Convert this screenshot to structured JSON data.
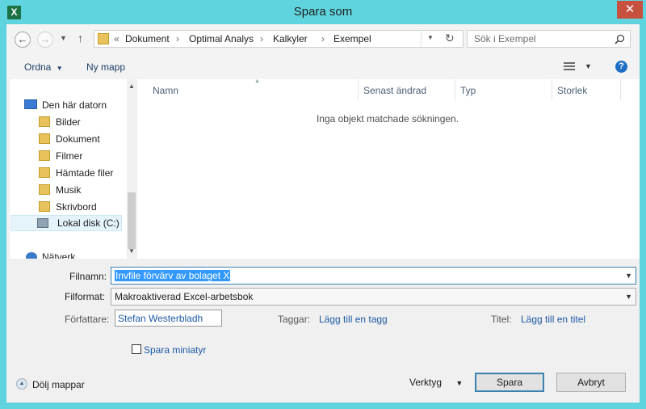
{
  "window": {
    "title": "Spara som",
    "close_glyph": "✕",
    "app_icon_letter": "X"
  },
  "address": {
    "crumbs": [
      "Dokument",
      "Optimal Analys",
      "Kalkyler",
      "Exempel"
    ],
    "overflow": "«",
    "search_placeholder": "Sök i Exempel"
  },
  "toolbar": {
    "organize": "Ordna",
    "new_folder": "Ny mapp",
    "help": "?"
  },
  "nav": {
    "this_pc": "Den här datorn",
    "items": [
      "Bilder",
      "Dokument",
      "Filmer",
      "Hämtade filer",
      "Musik",
      "Skrivbord"
    ],
    "local_disk": "Lokal disk (C:)",
    "network": "Nätverk"
  },
  "list": {
    "columns": [
      "Namn",
      "Senast ändrad",
      "Typ",
      "Storlek"
    ],
    "empty_message": "Inga objekt matchade sökningen."
  },
  "form": {
    "filename_label": "Filnamn:",
    "filename_value": "Invfile förvärv av bolaget X",
    "format_label": "Filformat:",
    "format_value": "Makroaktiverad Excel-arbetsbok",
    "author_label": "Författare:",
    "author_value": "Stefan Westerbladh",
    "tags_label": "Taggar:",
    "tags_link": "Lägg till en tagg",
    "title_label": "Titel:",
    "title_link": "Lägg till en titel",
    "thumbnail_label": "Spara miniatyr"
  },
  "footer": {
    "hide_folders": "Dölj mappar",
    "tools": "Verktyg",
    "save": "Spara",
    "cancel": "Avbryt"
  }
}
